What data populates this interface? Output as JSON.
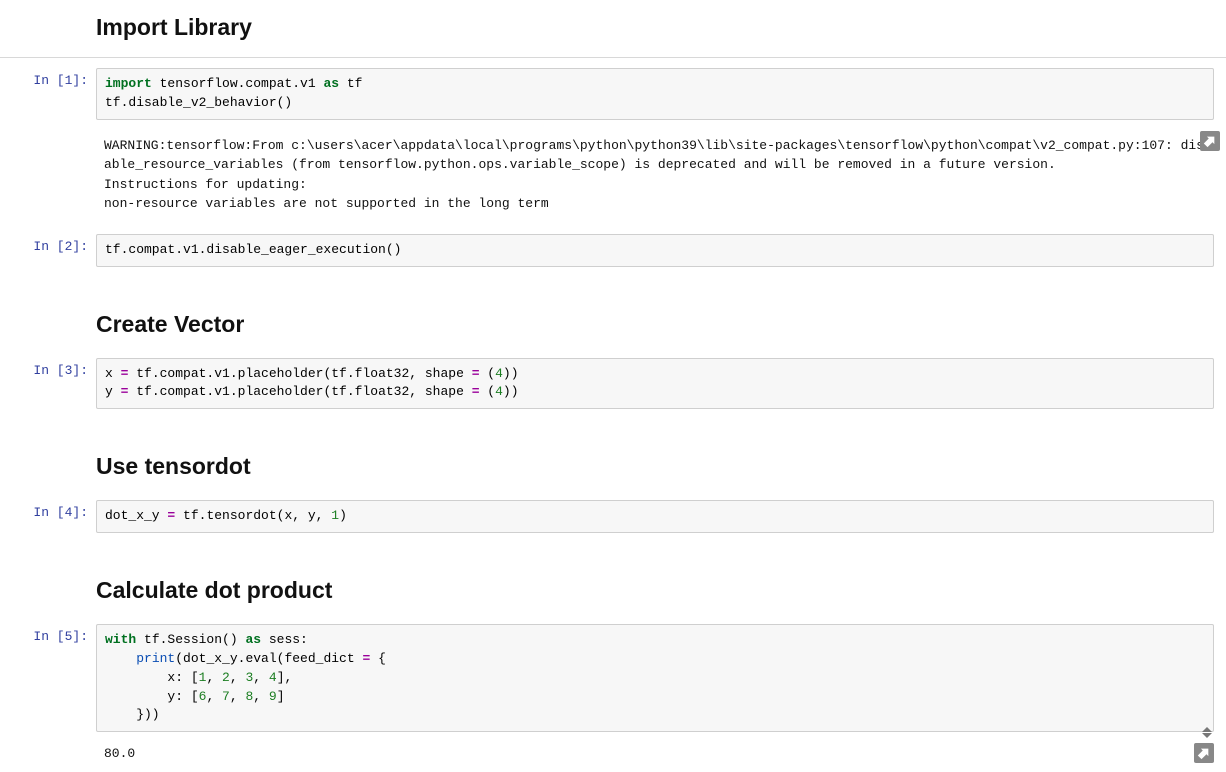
{
  "headings": {
    "h1": "Import Library",
    "h2": "Create Vector",
    "h3": "Use tensordot",
    "h4": "Calculate dot product"
  },
  "prompts": {
    "in1": "In [1]:",
    "in2": "In [2]:",
    "in3": "In [3]:",
    "in4": "In [4]:",
    "in5": "In [5]:"
  },
  "code": {
    "c1_l1_kw1": "import",
    "c1_l1_mid": " tensorflow.compat.v1 ",
    "c1_l1_kw2": "as",
    "c1_l1_end": " tf",
    "c1_l2": "tf.disable_v2_behavior()",
    "c2": "tf.compat.v1.disable_eager_execution()",
    "c3_l1a": "x ",
    "c3_l1b": "=",
    "c3_l1c": " tf.compat.v1.placeholder(tf.float32, shape ",
    "c3_l1d": "=",
    "c3_l1e": " (",
    "c3_l1f": "4",
    "c3_l1g": "))",
    "c3_l2a": "y ",
    "c3_l2b": "=",
    "c3_l2c": " tf.compat.v1.placeholder(tf.float32, shape ",
    "c3_l2d": "=",
    "c3_l2e": " (",
    "c3_l2f": "4",
    "c3_l2g": "))",
    "c4_a": "dot_x_y ",
    "c4_b": "=",
    "c4_c": " tf.tensordot(x, y, ",
    "c4_d": "1",
    "c4_e": ")",
    "c5_l1_kw1": "with",
    "c5_l1_mid": " tf.Session() ",
    "c5_l1_kw2": "as",
    "c5_l1_end": " sess:",
    "c5_l2_indent": "    ",
    "c5_l2_print": "print",
    "c5_l2_rest1": "(dot_x_y.eval(feed_dict ",
    "c5_l2_eq": "=",
    "c5_l2_rest2": " {",
    "c5_l3a": "        x: [",
    "c5_l3n1": "1",
    "c5_l3s": ", ",
    "c5_l3n2": "2",
    "c5_l3n3": "3",
    "c5_l3n4": "4",
    "c5_l3b": "],",
    "c5_l4a": "        y: [",
    "c5_l4n1": "6",
    "c5_l4n2": "7",
    "c5_l4n3": "8",
    "c5_l4n4": "9",
    "c5_l4b": "]",
    "c5_l5": "    }))"
  },
  "outputs": {
    "o1": "WARNING:tensorflow:From c:\\users\\acer\\appdata\\local\\programs\\python\\python39\\lib\\site-packages\\tensorflow\\python\\compat\\v2_compat.py:107: disable_resource_variables (from tensorflow.python.ops.variable_scope) is deprecated and will be removed in a future version.\nInstructions for updating:\nnon-resource variables are not supported in the long term",
    "o5": "80.0"
  },
  "icons": {
    "collapse": "collapse-output-icon",
    "scroll": "scroll-output-icon"
  }
}
